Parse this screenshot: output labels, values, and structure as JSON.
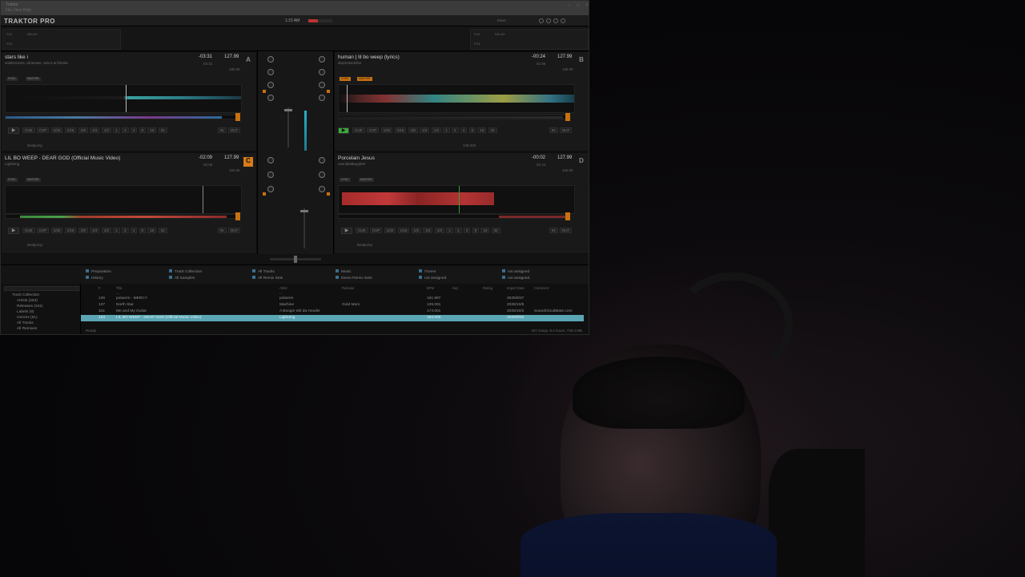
{
  "window": {
    "menu_label": "Traktor",
    "submenu": "File  View  Help",
    "brand": "TRAKTOR PRO",
    "clock": "1:15 AM",
    "mode_label": "Mixer"
  },
  "decks": {
    "A": {
      "letter": "A",
      "title": "stars like i",
      "artist": "underscores, drnessee, wmcs & friends",
      "time": "-03:31",
      "bpm": "127.99",
      "sub_time": "03:31",
      "sub_bpm": "180.00",
      "sync_label": "SYNC",
      "master_label": "MASTER",
      "cue_label": "CUE",
      "cup_label": "CUP",
      "in_label": "IN",
      "out_label": "OUT",
      "beatjump": "Beatjump",
      "loop_sizes": [
        "1/32",
        "1/16",
        "1/8",
        "1/4",
        "1/2",
        "1",
        "2",
        "4",
        "8",
        "16",
        "32"
      ]
    },
    "B": {
      "letter": "B",
      "title": "human  | lil bo weep (lyrics)",
      "artist": "depressedvibe",
      "time": "-00:24",
      "bpm": "127.99",
      "sub_time": "01:56",
      "sub_bpm": "138.00",
      "sync_label": "SYNC",
      "master_label": "MASTER",
      "cue_label": "CUE",
      "cup_label": "CUP",
      "in_label": "IN",
      "out_label": "OUT",
      "tempo_readout": "138.000",
      "loop_sizes": [
        "1/32",
        "1/16",
        "1/8",
        "1/4",
        "1/2",
        "1",
        "2",
        "4",
        "8",
        "16",
        "32"
      ]
    },
    "C": {
      "letter": "C",
      "title": "LIL BO WEEP - DEAR GOD (Official Music Video)",
      "artist": "Lightning",
      "time": "-02:09",
      "bpm": "127.99",
      "sub_time": "02:09",
      "sub_bpm": "164.00",
      "sync_label": "SYNC",
      "master_label": "MASTER",
      "cue_label": "CUE",
      "cup_label": "CUP",
      "in_label": "IN",
      "out_label": "OUT",
      "beatjump": "Beatjump",
      "loop_sizes": [
        "1/32",
        "1/16",
        "1/8",
        "1/4",
        "1/2",
        "1",
        "2",
        "4",
        "8",
        "16",
        "32"
      ]
    },
    "D": {
      "letter": "D",
      "title": "Porcelain Jesus",
      "artist": "cannibaldaughter",
      "time": "-00:02",
      "bpm": "127.99",
      "sub_time": "01:44",
      "sub_bpm": "115.00",
      "sync_label": "SYNC",
      "master_label": "MASTER",
      "cue_label": "CUE",
      "cup_label": "CUP",
      "in_label": "IN",
      "out_label": "OUT",
      "beatjump": "Beatjump",
      "loop_sizes": [
        "1/32",
        "1/16",
        "1/8",
        "1/4",
        "1/2",
        "1",
        "2",
        "4",
        "8",
        "16",
        "32"
      ]
    }
  },
  "favorites": [
    [
      "Preparation",
      "Track Collection",
      "All Tracks",
      "Music",
      "iTunes",
      "not assigned"
    ],
    [
      "History",
      "All Samples",
      "All Remix Sets",
      "Demo Remix Sets",
      "not assigned",
      "not assigned"
    ]
  ],
  "tree": [
    "Track Collection",
    "Artists (263)",
    "Releases (341)",
    "Labels (9)",
    "Genres (51)",
    "All Tracks",
    "All Remixes"
  ],
  "columns": [
    "#",
    "Title",
    "Artist",
    "Release",
    "BPM",
    "Key",
    "Rating",
    "Import Date",
    "Comment"
  ],
  "tracks": [
    {
      "n": "",
      "title": "...",
      "artist": "...",
      "release": "",
      "bpm": "",
      "key": "",
      "date": "",
      "comment": "",
      "sel": false
    },
    {
      "n": "136",
      "title": "polaerm - MERCY",
      "artist": "polaerm",
      "release": "",
      "bpm": "161.997",
      "key": "",
      "date": "2025/8/27",
      "comment": "",
      "sel": false
    },
    {
      "n": "137",
      "title": "North Star",
      "artist": "Machine",
      "release": "Gold Mom",
      "bpm": "139.001",
      "key": "",
      "date": "2025/10/5",
      "comment": "",
      "sel": false
    },
    {
      "n": "115",
      "title": "Me and My Guitar",
      "artist": "A Boogie Wit da Hoodie",
      "release": "",
      "bpm": "174.001",
      "key": "",
      "date": "2025/10/2",
      "comment": "SoundCloudMate.com",
      "sel": false
    },
    {
      "n": "123",
      "title": "LIL BO WEEP - DEAR GOD (Official Music Video)",
      "artist": "Lightning",
      "release": "",
      "bpm": "164.000",
      "key": "",
      "date": "2025/9/22",
      "comment": "",
      "sel": true
    }
  ],
  "status": {
    "left": "Ready",
    "right": "187 songs, 8.4 hours, 735.3 MB"
  }
}
